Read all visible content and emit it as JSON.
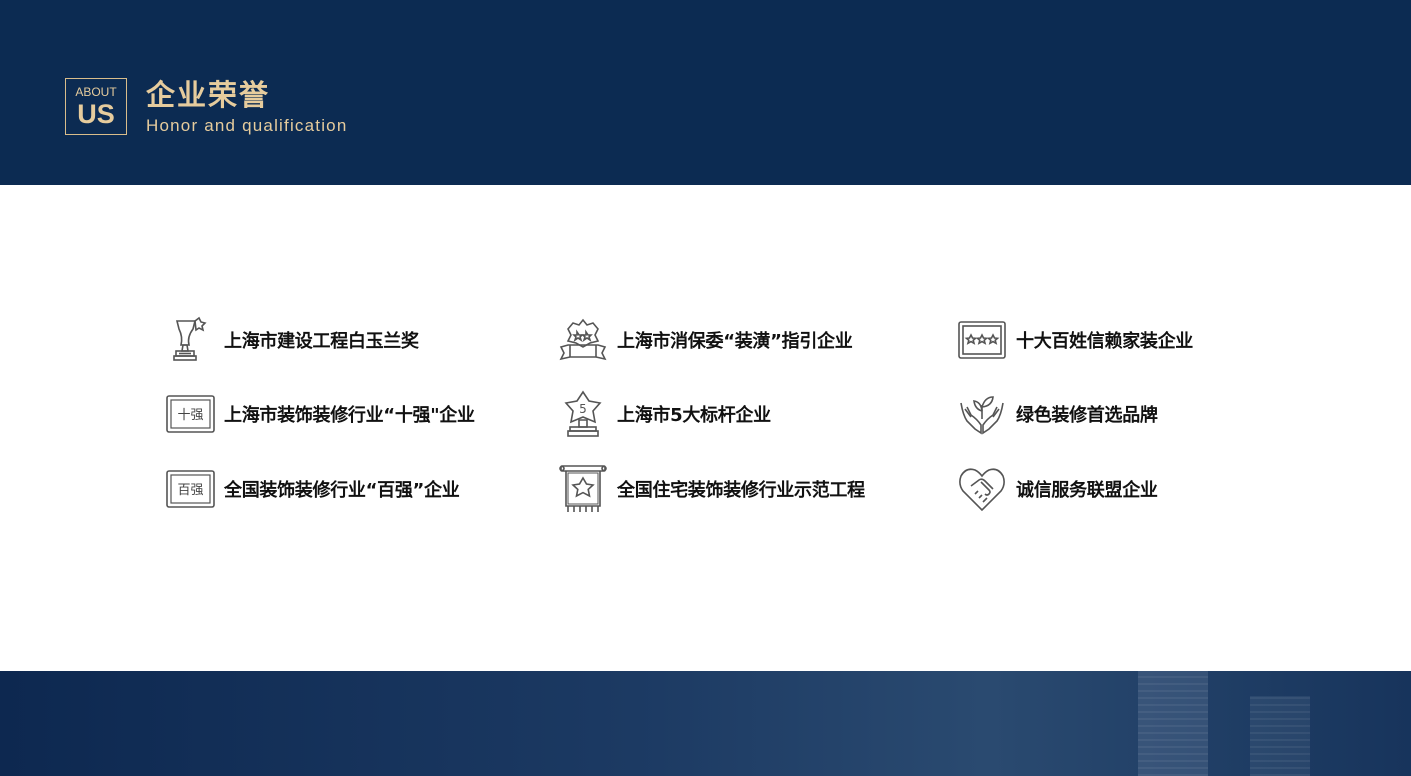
{
  "header": {
    "badge_small": "ABOUT",
    "badge_big": "US",
    "title": "企业荣誉",
    "subtitle": "Honor and qualification"
  },
  "honors": [
    {
      "label": "上海市建设工程白玉兰奖",
      "icon": "trophy-icon"
    },
    {
      "label": "上海市消保委“装潢”指引企业",
      "icon": "award-ribbon-icon"
    },
    {
      "label": "十大百姓信赖家装企业",
      "icon": "three-stars-plaque-icon"
    },
    {
      "label": "上海市装饰装修行业“十强\"企业",
      "icon": "shiqiang-plaque-icon",
      "plaque_text": "十强"
    },
    {
      "label": "上海市5大标杆企业",
      "icon": "star-5-trophy-icon",
      "badge_text": "5"
    },
    {
      "label": "绿色装修首选品牌",
      "icon": "hands-sprout-icon"
    },
    {
      "label": "全国装饰装修行业“百强”企业",
      "icon": "baiqiang-plaque-icon",
      "plaque_text": "百强"
    },
    {
      "label": "全国住宅装饰装修行业示范工程",
      "icon": "banner-star-icon"
    },
    {
      "label": "诚信服务联盟企业",
      "icon": "handshake-heart-icon"
    }
  ],
  "colors": {
    "navy": "#0c2b52",
    "gold": "#e6cc9d",
    "text": "#111111",
    "icon": "#555555"
  }
}
